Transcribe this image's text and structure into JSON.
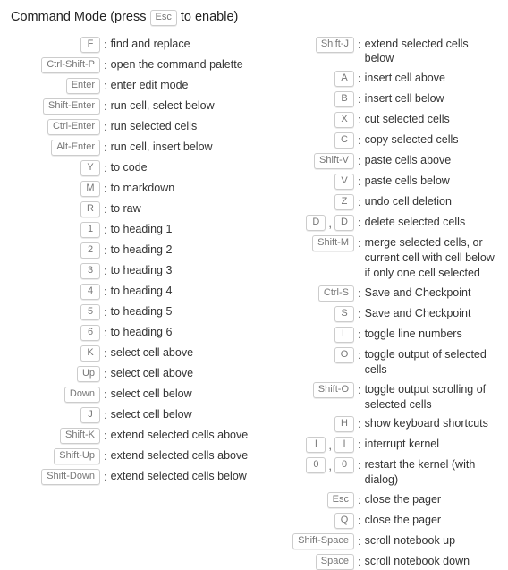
{
  "title": {
    "before": "Command Mode (press",
    "key": "Esc",
    "after": "to enable)"
  },
  "left": [
    {
      "keys": [
        "F"
      ],
      "desc": "find and replace"
    },
    {
      "keys": [
        "Ctrl-Shift-P"
      ],
      "desc": "open the command palette"
    },
    {
      "keys": [
        "Enter"
      ],
      "desc": "enter edit mode"
    },
    {
      "keys": [
        "Shift-Enter"
      ],
      "desc": "run cell, select below"
    },
    {
      "keys": [
        "Ctrl-Enter"
      ],
      "desc": "run selected cells"
    },
    {
      "keys": [
        "Alt-Enter"
      ],
      "desc": "run cell, insert below"
    },
    {
      "keys": [
        "Y"
      ],
      "desc": "to code"
    },
    {
      "keys": [
        "M"
      ],
      "desc": "to markdown"
    },
    {
      "keys": [
        "R"
      ],
      "desc": "to raw"
    },
    {
      "keys": [
        "1"
      ],
      "desc": "to heading 1"
    },
    {
      "keys": [
        "2"
      ],
      "desc": "to heading 2"
    },
    {
      "keys": [
        "3"
      ],
      "desc": "to heading 3"
    },
    {
      "keys": [
        "4"
      ],
      "desc": "to heading 4"
    },
    {
      "keys": [
        "5"
      ],
      "desc": "to heading 5"
    },
    {
      "keys": [
        "6"
      ],
      "desc": "to heading 6"
    },
    {
      "keys": [
        "K"
      ],
      "desc": "select cell above"
    },
    {
      "keys": [
        "Up"
      ],
      "desc": "select cell above"
    },
    {
      "keys": [
        "Down"
      ],
      "desc": "select cell below"
    },
    {
      "keys": [
        "J"
      ],
      "desc": "select cell below"
    },
    {
      "keys": [
        "Shift-K"
      ],
      "desc": "extend selected cells above"
    },
    {
      "keys": [
        "Shift-Up"
      ],
      "desc": "extend selected cells above"
    },
    {
      "keys": [
        "Shift-Down"
      ],
      "desc": "extend selected cells below"
    }
  ],
  "right": [
    {
      "keys": [
        "Shift-J"
      ],
      "desc": "extend selected cells below"
    },
    {
      "keys": [
        "A"
      ],
      "desc": "insert cell above"
    },
    {
      "keys": [
        "B"
      ],
      "desc": "insert cell below"
    },
    {
      "keys": [
        "X"
      ],
      "desc": "cut selected cells"
    },
    {
      "keys": [
        "C"
      ],
      "desc": "copy selected cells"
    },
    {
      "keys": [
        "Shift-V"
      ],
      "desc": "paste cells above"
    },
    {
      "keys": [
        "V"
      ],
      "desc": "paste cells below"
    },
    {
      "keys": [
        "Z"
      ],
      "desc": "undo cell deletion"
    },
    {
      "keys": [
        "D",
        "D"
      ],
      "desc": "delete selected cells"
    },
    {
      "keys": [
        "Shift-M"
      ],
      "desc": "merge selected cells, or current cell with cell below if only one cell selected"
    },
    {
      "keys": [
        "Ctrl-S"
      ],
      "desc": "Save and Checkpoint"
    },
    {
      "keys": [
        "S"
      ],
      "desc": "Save and Checkpoint"
    },
    {
      "keys": [
        "L"
      ],
      "desc": "toggle line numbers"
    },
    {
      "keys": [
        "O"
      ],
      "desc": "toggle output of selected cells"
    },
    {
      "keys": [
        "Shift-O"
      ],
      "desc": "toggle output scrolling of selected cells"
    },
    {
      "keys": [
        "H"
      ],
      "desc": "show keyboard shortcuts"
    },
    {
      "keys": [
        "I",
        "I"
      ],
      "desc": "interrupt kernel"
    },
    {
      "keys": [
        "0",
        "0"
      ],
      "desc": "restart the kernel (with dialog)"
    },
    {
      "keys": [
        "Esc"
      ],
      "desc": "close the pager"
    },
    {
      "keys": [
        "Q"
      ],
      "desc": "close the pager"
    },
    {
      "keys": [
        "Shift-Space"
      ],
      "desc": "scroll notebook up"
    },
    {
      "keys": [
        "Space"
      ],
      "desc": "scroll notebook down"
    }
  ]
}
